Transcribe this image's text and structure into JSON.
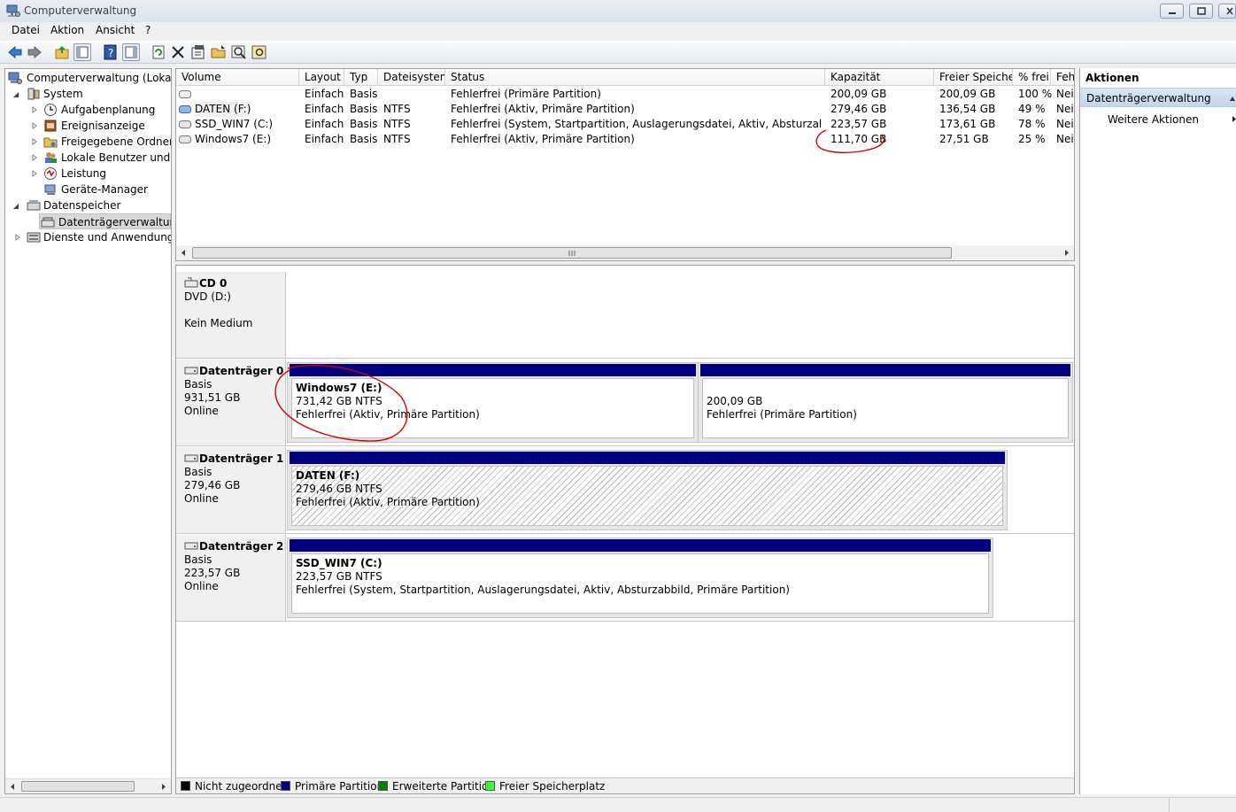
{
  "window": {
    "title": "Computerverwaltung",
    "icon": "computer-management-icon"
  },
  "menu": [
    "Datei",
    "Aktion",
    "Ansicht",
    "?"
  ],
  "toolbar": [
    "back-arrow-icon",
    "forward-arrow-icon",
    "up-folder-icon",
    "show-hide-tree-icon",
    "help-icon",
    "show-hide-action-pane-icon",
    "refresh-icon",
    "delete-icon",
    "properties-icon",
    "open-folder-icon",
    "search-icon",
    "settings-icon"
  ],
  "tree": {
    "root": "Computerverwaltung (Lokal)",
    "system": "System",
    "system_items": [
      "Aufgabenplanung",
      "Ereignisanzeige",
      "Freigegebene Ordner",
      "Lokale Benutzer und Gr",
      "Leistung",
      "Geräte-Manager"
    ],
    "storage": "Datenspeicher",
    "storage_items": [
      "Datenträgerverwaltung"
    ],
    "services": "Dienste und Anwendungen"
  },
  "volume_list": {
    "columns": [
      "Volume",
      "Layout",
      "Typ",
      "Dateisystem",
      "Status",
      "Kapazität",
      "Freier Speicher",
      "% frei",
      "Feh"
    ],
    "rows": [
      {
        "volume": "",
        "layout": "Einfach",
        "typ": "Basis",
        "fs": "",
        "status": "Fehlerfrei (Primäre Partition)",
        "capacity": "200,09 GB",
        "free": "200,09 GB",
        "pct": "100 %",
        "fault": "Nein"
      },
      {
        "volume": "DATEN (F:)",
        "layout": "Einfach",
        "typ": "Basis",
        "fs": "NTFS",
        "status": "Fehlerfrei (Aktiv, Primäre Partition)",
        "capacity": "279,46 GB",
        "free": "136,54 GB",
        "pct": "49 %",
        "fault": "Nein"
      },
      {
        "volume": "SSD_WIN7 (C:)",
        "layout": "Einfach",
        "typ": "Basis",
        "fs": "NTFS",
        "status": "Fehlerfrei (System, Startpartition, Auslagerungsdatei, Aktiv, Absturzabbild, Pri...",
        "capacity": "223,57 GB",
        "free": "173,61 GB",
        "pct": "78 %",
        "fault": "Nein"
      },
      {
        "volume": "Windows7 (E:)",
        "layout": "Einfach",
        "typ": "Basis",
        "fs": "NTFS",
        "status": "Fehlerfrei (Aktiv, Primäre Partition)",
        "capacity": "111,70 GB",
        "free": "27,51 GB",
        "pct": "25 %",
        "fault": "Nein"
      }
    ]
  },
  "disks": [
    {
      "name": "CD 0",
      "lines": [
        "DVD (D:)",
        "",
        "Kein Medium"
      ]
    },
    {
      "name": "Datenträger 0",
      "lines": [
        "Basis",
        "931,51 GB",
        "Online"
      ],
      "partitions": [
        {
          "name": "Windows7  (E:)",
          "size": "731,42 GB NTFS",
          "status": "Fehlerfrei (Aktiv, Primäre Partition)"
        },
        {
          "name": "",
          "size": "200,09 GB",
          "status": "Fehlerfrei (Primäre Partition)"
        }
      ]
    },
    {
      "name": "Datenträger 1",
      "lines": [
        "Basis",
        "279,46 GB",
        "Online"
      ],
      "partitions": [
        {
          "name": "DATEN  (F:)",
          "size": "279,46 GB NTFS",
          "status": "Fehlerfrei (Aktiv, Primäre Partition)"
        }
      ]
    },
    {
      "name": "Datenträger 2",
      "lines": [
        "Basis",
        "223,57 GB",
        "Online"
      ],
      "partitions": [
        {
          "name": "SSD_WIN7  (C:)",
          "size": "223,57 GB NTFS",
          "status": "Fehlerfrei (System, Startpartition, Auslagerungsdatei, Aktiv, Absturzabbild, Primäre Partition)"
        }
      ]
    }
  ],
  "legend": [
    {
      "label": "Nicht zugeordnet",
      "color": "#000000"
    },
    {
      "label": "Primäre Partition",
      "color": "#000080"
    },
    {
      "label": "Erweiterte Partition",
      "color": "#008000"
    },
    {
      "label": "Freier Speicherplatz",
      "color": "#33ff33"
    }
  ],
  "actions": {
    "title": "Aktionen",
    "section": "Datenträgerverwaltung",
    "more": "Weitere Aktionen"
  },
  "annotation_color": "#d40000"
}
